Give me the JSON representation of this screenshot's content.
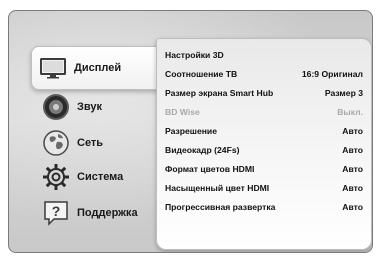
{
  "sidebar": {
    "items": [
      {
        "label": "Дисплей",
        "icon": "display-icon",
        "active": true
      },
      {
        "label": "Звук",
        "icon": "speaker-icon",
        "active": false
      },
      {
        "label": "Сеть",
        "icon": "globe-icon",
        "active": false
      },
      {
        "label": "Система",
        "icon": "gear-icon",
        "active": false
      },
      {
        "label": "Поддержка",
        "icon": "help-icon",
        "active": false
      }
    ]
  },
  "settings": {
    "rows": [
      {
        "label": "Настройки 3D",
        "value": "",
        "disabled": false
      },
      {
        "label": "Соотношение ТВ",
        "value": "16:9 Оригинал",
        "disabled": false
      },
      {
        "label": "Размер экрана Smart Hub",
        "value": "Размер 3",
        "disabled": false
      },
      {
        "label": "BD Wise",
        "value": "Выкл.",
        "disabled": true
      },
      {
        "label": "Разрешение",
        "value": "Авто",
        "disabled": false
      },
      {
        "label": "Видеокадр (24Fs)",
        "value": "Авто",
        "disabled": false
      },
      {
        "label": "Формат цветов HDMI",
        "value": "Авто",
        "disabled": false
      },
      {
        "label": "Насыщенный цвет HDMI",
        "value": "Авто",
        "disabled": false
      },
      {
        "label": "Прогрессивная развертка",
        "value": "Авто",
        "disabled": false
      }
    ]
  },
  "colors": {
    "frame_bg": "#cfcfcf",
    "panel_bg": "#f4f4f4",
    "text": "#111111",
    "disabled_text": "#a9a9a9"
  }
}
